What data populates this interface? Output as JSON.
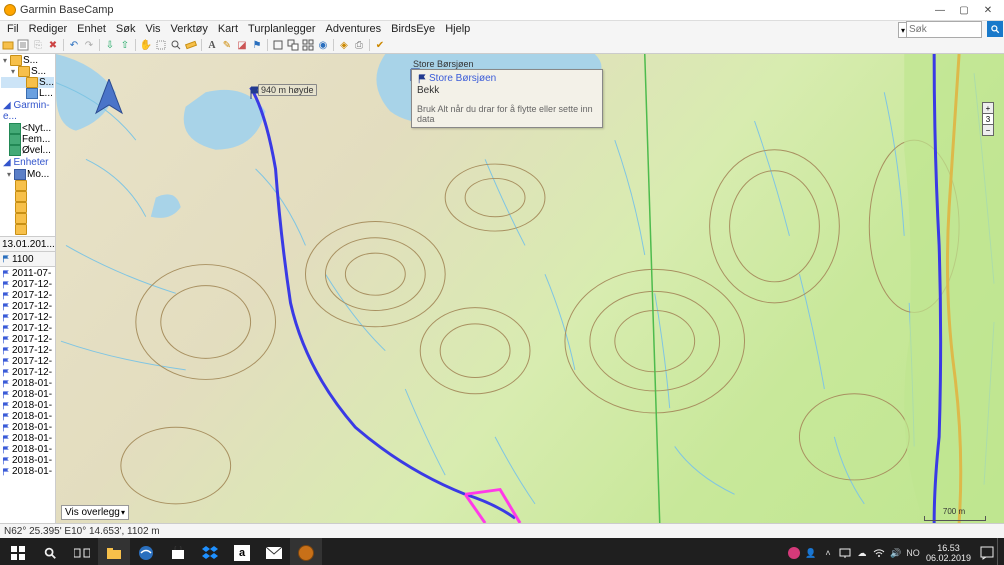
{
  "app": {
    "title": "Garmin BaseCamp"
  },
  "menu": {
    "items": [
      "Fil",
      "Rediger",
      "Enhet",
      "Søk",
      "Vis",
      "Verktøy",
      "Kart",
      "Turplanlegger",
      "Adventures",
      "BirdsEye",
      "Hjelp"
    ],
    "search_placeholder": "Søk"
  },
  "tree": {
    "items": [
      {
        "label": "S...",
        "icon": "folder",
        "indent": 0,
        "sel": false
      },
      {
        "label": "S...",
        "icon": "folder",
        "indent": 1,
        "sel": false
      },
      {
        "label": "S...",
        "icon": "folder",
        "indent": 2,
        "sel": true
      },
      {
        "label": "L...",
        "icon": "list",
        "indent": 2,
        "sel": false
      }
    ],
    "group2_header": "Garmin-e...",
    "group2": [
      {
        "label": "<Nyt...",
        "icon": "dev",
        "indent": 0
      },
      {
        "label": "Fem...",
        "icon": "dev",
        "indent": 0
      },
      {
        "label": "Øvel...",
        "icon": "dev",
        "indent": 0
      }
    ],
    "group3_header": "Enheter",
    "group3": [
      {
        "label": "Mo...",
        "icon": "blue",
        "indent": 0
      },
      {
        "label": "",
        "icon": "folder",
        "indent": 1
      },
      {
        "label": "",
        "icon": "folder",
        "indent": 1
      },
      {
        "label": "",
        "icon": "folder",
        "indent": 1
      },
      {
        "label": "",
        "icon": "folder",
        "indent": 1
      },
      {
        "label": "",
        "icon": "folder",
        "indent": 1
      }
    ]
  },
  "list": {
    "header": "13.01.201...",
    "title": "1100",
    "items": [
      "2011-07-",
      "2017-12-",
      "2017-12-",
      "2017-12-",
      "2017-12-",
      "2017-12-",
      "2017-12-",
      "2017-12-",
      "2017-12-",
      "2017-12-",
      "2018-01-",
      "2018-01-",
      "2018-01-",
      "2018-01-",
      "2018-01-",
      "2018-01-",
      "2018-01-",
      "2018-01-",
      "2018-01-"
    ]
  },
  "map": {
    "marker1_label": "940 m høyde",
    "poi_label": "Store Børsjøen",
    "tooltip_title": "Store Børsjøen",
    "tooltip_sub": "Bekk",
    "tooltip_hint": "Bruk Alt når du drar for å flytte eller sette inn data",
    "overlay_label": "Vis overlegg",
    "scale_label": "700 m",
    "zoom_level": "3"
  },
  "status": {
    "text": "N62° 25.395' E10° 14.653', 1102 m"
  },
  "taskbar": {
    "time": "16.53",
    "date": "06.02.2019"
  }
}
